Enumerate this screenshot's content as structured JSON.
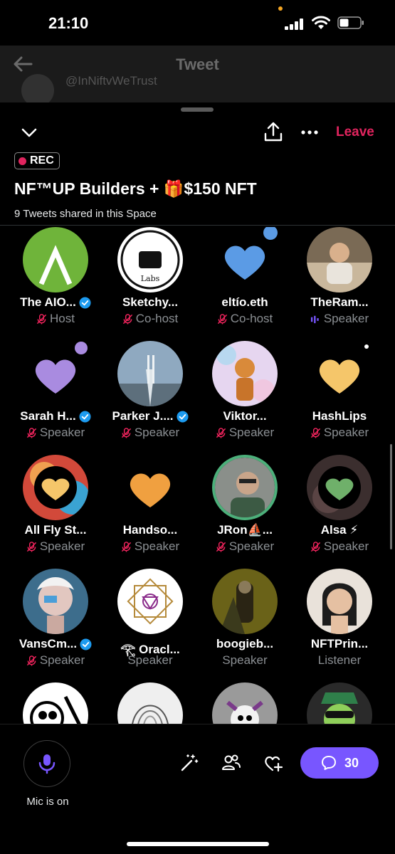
{
  "status": {
    "time": "21:10"
  },
  "background": {
    "title": "Tweet",
    "handle": "@InNiftvWeTrust"
  },
  "header": {
    "leave_label": "Leave",
    "rec_label": "REC"
  },
  "space": {
    "title": "NF™UP Builders + 🎁$150 NFT",
    "subtitle": "9 Tweets shared in this Space"
  },
  "participants": [
    {
      "name": "The AIO...",
      "role": "Host",
      "verified": true,
      "role_icon": "mic-muted-icon"
    },
    {
      "name": "Sketchy...",
      "role": "Co-host",
      "verified": false,
      "role_icon": "mic-muted-icon"
    },
    {
      "name": "eltío.eth",
      "role": "Co-host",
      "verified": false,
      "role_icon": "mic-muted-icon"
    },
    {
      "name": "TheRam...",
      "role": "Speaker",
      "verified": false,
      "role_icon": "speaking-bars-icon"
    },
    {
      "name": "Sarah H...",
      "role": "Speaker",
      "verified": true,
      "role_icon": "mic-muted-icon"
    },
    {
      "name": "Parker J....",
      "role": "Speaker",
      "verified": true,
      "role_icon": "mic-muted-icon"
    },
    {
      "name": "Viktor...",
      "role": "Speaker",
      "verified": false,
      "role_icon": "mic-muted-icon"
    },
    {
      "name": "HashLips",
      "role": "Speaker",
      "verified": false,
      "role_icon": "mic-muted-icon"
    },
    {
      "name": "All Fly St...",
      "role": "Speaker",
      "verified": false,
      "role_icon": "mic-muted-icon"
    },
    {
      "name": "Handso...",
      "role": "Speaker",
      "verified": false,
      "role_icon": "mic-muted-icon"
    },
    {
      "name": "JRon⛵...",
      "role": "Speaker",
      "verified": false,
      "role_icon": "mic-muted-icon"
    },
    {
      "name": "Alsa ⚡",
      "role": "Speaker",
      "verified": false,
      "role_icon": "mic-muted-icon"
    },
    {
      "name": "VansCm...",
      "role": "Speaker",
      "verified": true,
      "role_icon": "mic-muted-icon"
    },
    {
      "name": "𓂀 Oracl...",
      "role": "Speaker",
      "verified": false,
      "role_icon": "none"
    },
    {
      "name": "boogieb...",
      "role": "Speaker",
      "verified": false,
      "role_icon": "none"
    },
    {
      "name": "NFTPrin...",
      "role": "Listener",
      "verified": false,
      "role_icon": "none"
    }
  ],
  "bottom": {
    "mic_label": "Mic is on",
    "comment_count": "30"
  },
  "colors": {
    "accent": "#7856ff",
    "leave": "#e0245e",
    "muted": "#8b8f93"
  }
}
